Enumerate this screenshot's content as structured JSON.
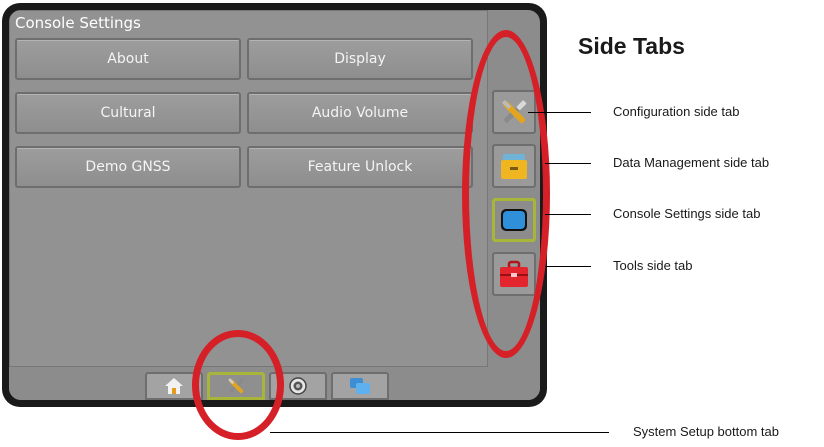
{
  "console": {
    "panel_title": "Console Settings",
    "buttons": [
      "About",
      "Display",
      "Cultural",
      "Audio Volume",
      "Demo GNSS",
      "Feature Unlock"
    ],
    "side_tabs": [
      {
        "icon": "wrench-screwdriver-icon",
        "active": false
      },
      {
        "icon": "file-drawer-icon",
        "active": false
      },
      {
        "icon": "monitor-screen-icon",
        "active": true
      },
      {
        "icon": "toolbox-icon",
        "active": false
      }
    ],
    "bottom_tabs": [
      {
        "icon": "home-icon",
        "active": false
      },
      {
        "icon": "wrench-screwdriver-icon",
        "active": true
      },
      {
        "icon": "gnss-target-icon",
        "active": false
      },
      {
        "icon": "layers-icon",
        "active": false
      }
    ]
  },
  "annotations": {
    "heading": "Side Tabs",
    "callouts": [
      "Configuration side tab",
      "Data Management side tab",
      "Console Settings side tab",
      "Tools side tab",
      "System Setup bottom tab"
    ],
    "highlight_color": "#d62027"
  },
  "colors": {
    "active_tab_border": "#a7b53a",
    "panel_bg": "#929292",
    "frame": "#1a1a1a"
  }
}
